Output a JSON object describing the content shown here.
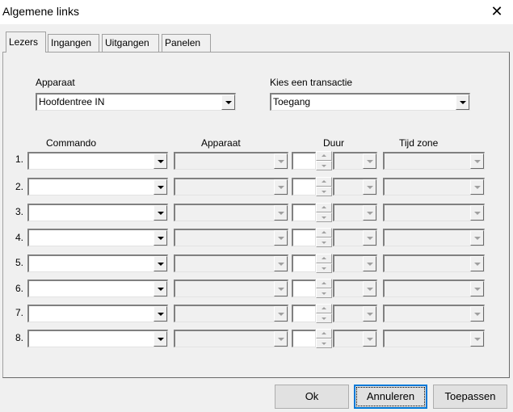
{
  "window": {
    "title": "Algemene links",
    "close_glyph": "✕"
  },
  "tabs": [
    {
      "label": "Lezers",
      "active": true
    },
    {
      "label": "Ingangen",
      "active": false
    },
    {
      "label": "Uitgangen",
      "active": false
    },
    {
      "label": "Panelen",
      "active": false
    }
  ],
  "top_fields": {
    "device_label": "Apparaat",
    "device_value": "Hoofdentree IN",
    "transaction_label": "Kies een transactie",
    "transaction_value": "Toegang"
  },
  "grid_headers": {
    "command": "Commando",
    "device": "Apparaat",
    "duration": "Duur",
    "timezone": "Tijd zone"
  },
  "rows": [
    {
      "num": "1."
    },
    {
      "num": "2."
    },
    {
      "num": "3."
    },
    {
      "num": "4."
    },
    {
      "num": "5."
    },
    {
      "num": "6."
    },
    {
      "num": "7."
    },
    {
      "num": "8."
    }
  ],
  "buttons": {
    "ok": "Ok",
    "cancel": "Annuleren",
    "apply": "Toepassen"
  }
}
